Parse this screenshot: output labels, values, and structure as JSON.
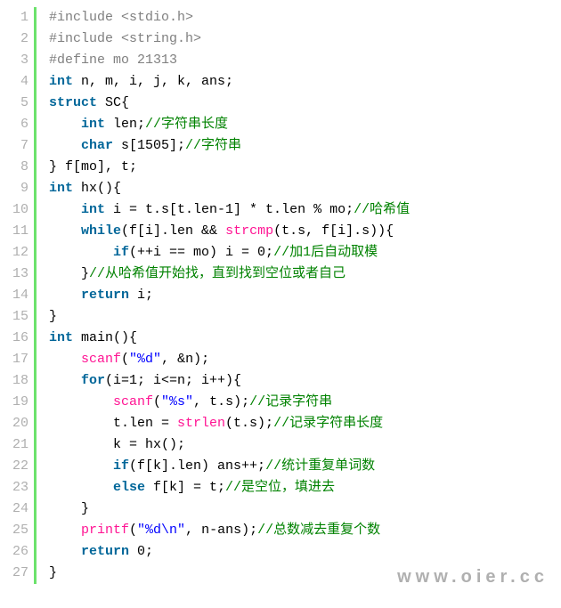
{
  "watermark": "www.oier.cc",
  "lines": [
    {
      "no": 1,
      "tokens": [
        {
          "c": "pp",
          "t": "#include <stdio.h>"
        }
      ]
    },
    {
      "no": 2,
      "tokens": [
        {
          "c": "pp",
          "t": "#include <string.h>"
        }
      ]
    },
    {
      "no": 3,
      "tokens": [
        {
          "c": "pp",
          "t": "#define mo 21313"
        }
      ]
    },
    {
      "no": 4,
      "tokens": [
        {
          "c": "ty",
          "t": "int"
        },
        {
          "t": " n, m, i, j, k, ans;"
        }
      ]
    },
    {
      "no": 5,
      "tokens": [
        {
          "c": "kw",
          "t": "struct"
        },
        {
          "t": " SC{"
        }
      ]
    },
    {
      "no": 6,
      "tokens": [
        {
          "t": "    "
        },
        {
          "c": "ty",
          "t": "int"
        },
        {
          "t": " len;"
        },
        {
          "c": "cm",
          "t": "//字符串长度"
        }
      ]
    },
    {
      "no": 7,
      "tokens": [
        {
          "t": "    "
        },
        {
          "c": "ty",
          "t": "char"
        },
        {
          "t": " s[1505];"
        },
        {
          "c": "cm",
          "t": "//字符串"
        }
      ]
    },
    {
      "no": 8,
      "tokens": [
        {
          "t": "} f[mo], t;"
        }
      ]
    },
    {
      "no": 9,
      "tokens": [
        {
          "c": "ty",
          "t": "int"
        },
        {
          "t": " hx(){"
        }
      ]
    },
    {
      "no": 10,
      "tokens": [
        {
          "t": "    "
        },
        {
          "c": "ty",
          "t": "int"
        },
        {
          "t": " i = t.s[t.len-1] * t.len % mo;"
        },
        {
          "c": "cm",
          "t": "//哈希值"
        }
      ]
    },
    {
      "no": 11,
      "tokens": [
        {
          "t": "    "
        },
        {
          "c": "kw",
          "t": "while"
        },
        {
          "t": "(f[i].len && "
        },
        {
          "c": "fn",
          "t": "strcmp"
        },
        {
          "t": "(t.s, f[i].s)){"
        }
      ]
    },
    {
      "no": 12,
      "tokens": [
        {
          "t": "        "
        },
        {
          "c": "kw",
          "t": "if"
        },
        {
          "t": "(++i == mo) i = 0;"
        },
        {
          "c": "cm",
          "t": "//加1后自动取模"
        }
      ]
    },
    {
      "no": 13,
      "tokens": [
        {
          "t": "    }"
        },
        {
          "c": "cm",
          "t": "//从哈希值开始找，直到找到空位或者自己"
        }
      ]
    },
    {
      "no": 14,
      "tokens": [
        {
          "t": "    "
        },
        {
          "c": "kw",
          "t": "return"
        },
        {
          "t": " i;"
        }
      ]
    },
    {
      "no": 15,
      "tokens": [
        {
          "t": "}"
        }
      ]
    },
    {
      "no": 16,
      "tokens": [
        {
          "c": "ty",
          "t": "int"
        },
        {
          "t": " main(){"
        }
      ]
    },
    {
      "no": 17,
      "tokens": [
        {
          "t": "    "
        },
        {
          "c": "fn",
          "t": "scanf"
        },
        {
          "t": "("
        },
        {
          "c": "st",
          "t": "\"%d\""
        },
        {
          "t": ", &n);"
        }
      ]
    },
    {
      "no": 18,
      "tokens": [
        {
          "t": "    "
        },
        {
          "c": "kw",
          "t": "for"
        },
        {
          "t": "(i=1; i<=n; i++){"
        }
      ]
    },
    {
      "no": 19,
      "tokens": [
        {
          "t": "        "
        },
        {
          "c": "fn",
          "t": "scanf"
        },
        {
          "t": "("
        },
        {
          "c": "st",
          "t": "\"%s\""
        },
        {
          "t": ", t.s);"
        },
        {
          "c": "cm",
          "t": "//记录字符串"
        }
      ]
    },
    {
      "no": 20,
      "tokens": [
        {
          "t": "        t.len = "
        },
        {
          "c": "fn",
          "t": "strlen"
        },
        {
          "t": "(t.s);"
        },
        {
          "c": "cm",
          "t": "//记录字符串长度"
        }
      ]
    },
    {
      "no": 21,
      "tokens": [
        {
          "t": "        k = hx();"
        }
      ]
    },
    {
      "no": 22,
      "tokens": [
        {
          "t": "        "
        },
        {
          "c": "kw",
          "t": "if"
        },
        {
          "t": "(f[k].len) ans++;"
        },
        {
          "c": "cm",
          "t": "//统计重复单词数"
        }
      ]
    },
    {
      "no": 23,
      "tokens": [
        {
          "t": "        "
        },
        {
          "c": "kw",
          "t": "else"
        },
        {
          "t": " f[k] = t;"
        },
        {
          "c": "cm",
          "t": "//是空位，填进去"
        }
      ]
    },
    {
      "no": 24,
      "tokens": [
        {
          "t": "    }"
        }
      ]
    },
    {
      "no": 25,
      "tokens": [
        {
          "t": "    "
        },
        {
          "c": "fn",
          "t": "printf"
        },
        {
          "t": "("
        },
        {
          "c": "st",
          "t": "\"%d\\n\""
        },
        {
          "t": ", n-ans);"
        },
        {
          "c": "cm",
          "t": "//总数减去重复个数"
        }
      ]
    },
    {
      "no": 26,
      "tokens": [
        {
          "t": "    "
        },
        {
          "c": "kw",
          "t": "return"
        },
        {
          "t": " 0;"
        }
      ]
    },
    {
      "no": 27,
      "tokens": [
        {
          "t": "}"
        }
      ]
    }
  ]
}
